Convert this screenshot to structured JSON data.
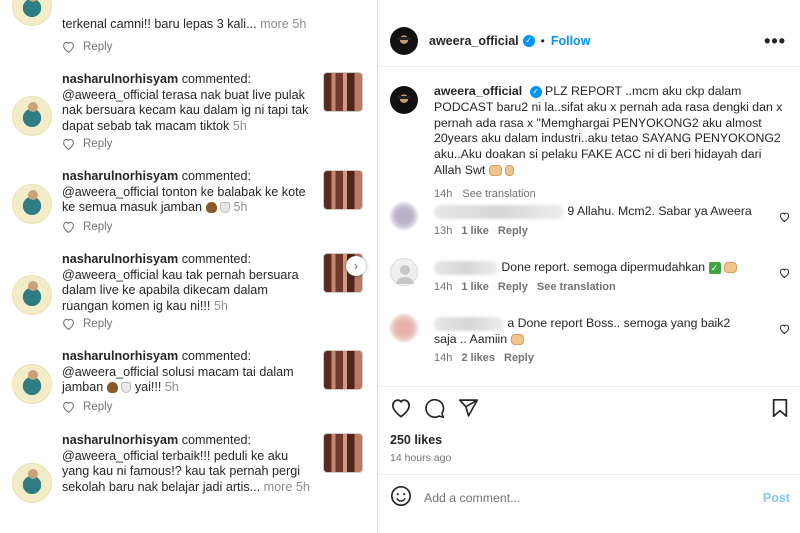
{
  "left": {
    "n0": {
      "text": "terkenal camni!! baru lepas 3 kali...",
      "more": "more",
      "time": "5h",
      "reply": "Reply"
    },
    "n1": {
      "user": "nasharulnorhisyam",
      "verb": "commented:",
      "body": "@aweera_official terasa nak buat live pulak nak bersuara kecam kau dalam ig ni tapi tak dapat sebab tak macam tiktok",
      "time": "5h",
      "reply": "Reply"
    },
    "n2": {
      "user": "nasharulnorhisyam",
      "verb": "commented:",
      "body": "@aweera_official tonton ke balabak ke kote ke semua masuk jamban",
      "time": "5h",
      "reply": "Reply"
    },
    "n3": {
      "user": "nasharulnorhisyam",
      "verb": "commented:",
      "body": "@aweera_official kau tak pernah bersuara dalam live ke apabila dikecam dalam ruangan komen ig kau ni!!!",
      "time": "5h",
      "reply": "Reply"
    },
    "n4": {
      "user": "nasharulnorhisyam",
      "verb": "commented:",
      "body": "@aweera_official solusi macam tai dalam jamban",
      "tail": "yai!!!",
      "time": "5h",
      "reply": "Reply"
    },
    "n5": {
      "user": "nasharulnorhisyam",
      "verb": "commented:",
      "body": "@aweera_official terbaik!!! peduli ke aku yang kau ni famous!? kau tak pernah pergi sekolah baru nak belajar jadi artis...",
      "more": "more",
      "time": "5h"
    }
  },
  "post": {
    "username": "aweera_official",
    "dot": "•",
    "follow": "Follow",
    "more": "•••",
    "caption": "PLZ REPORT ..mcm aku ckp dalam PODCAST baru2 ni la..sifat aku x pernah ada rasa dengki dan x pernah ada rasa x \"Memghargai PENYOKONG2 aku almost 20years aku dalam industri..aku tetao SAYANG PENYOKONG2 aku..Aku doakan si pelaku FAKE ACC ni di beri hidayah dari Allah Swt",
    "caption_time": "14h",
    "see_translation": "See translation",
    "comments": [
      {
        "text": "9 Allahu. Mcm2. Sabar ya Aweera",
        "time": "13h",
        "likes": "1 like",
        "reply": "Reply"
      },
      {
        "text": "Done report. semoga dipermudahkan",
        "time": "14h",
        "likes": "1 like",
        "reply": "Reply",
        "translation": "See translation"
      },
      {
        "text": "a Done report Boss.. semoga yang baik2 saja .. Aamiin",
        "time": "14h",
        "likes": "2 likes",
        "reply": "Reply"
      }
    ],
    "likes_count": "250 likes",
    "ago": "14 hours ago",
    "add_placeholder": "Add a comment...",
    "post_button": "Post"
  },
  "colors": {
    "accent": "#0095f6",
    "post_disabled": "#86c6f4",
    "muted": "#737373"
  }
}
